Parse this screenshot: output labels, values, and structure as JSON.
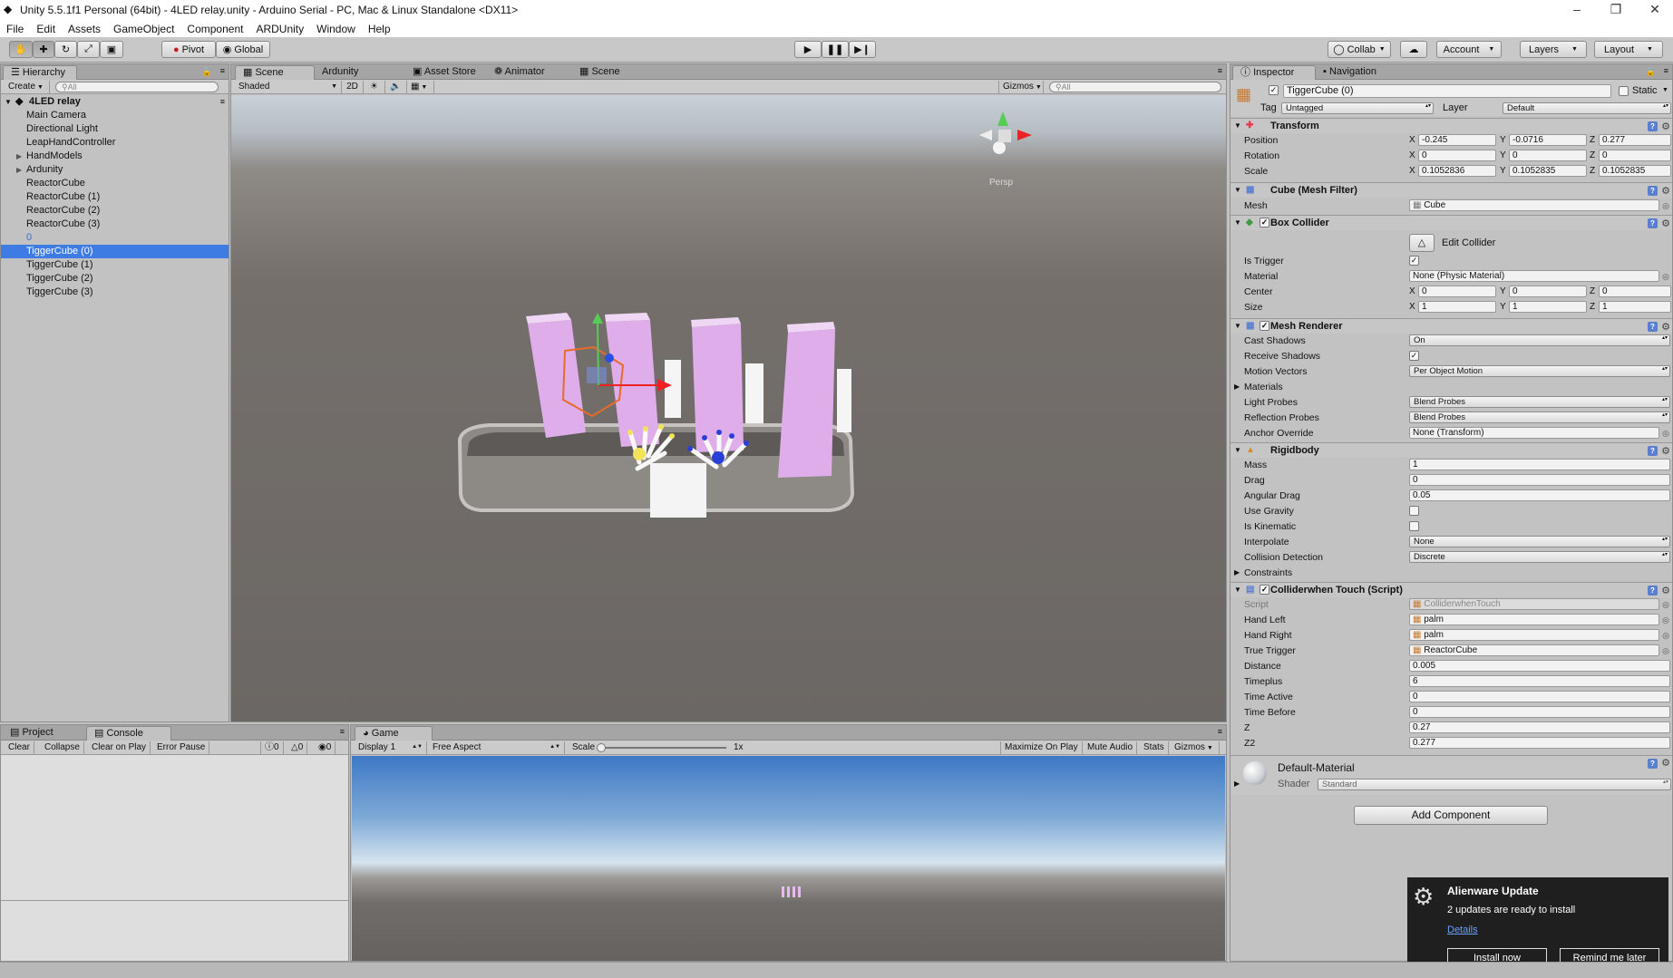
{
  "window": {
    "title": "Unity 5.5.1f1 Personal (64bit) - 4LED relay.unity - Arduino Serial - PC, Mac & Linux Standalone <DX11>"
  },
  "menu": [
    "File",
    "Edit",
    "Assets",
    "GameObject",
    "Component",
    "ARDUnity",
    "Window",
    "Help"
  ],
  "toolbar": {
    "pivot": "Pivot",
    "global": "Global",
    "collab": "Collab",
    "account": "Account",
    "layers": "Layers",
    "layout": "Layout"
  },
  "hierarchy": {
    "tab": "Hierarchy",
    "create": "Create",
    "search_placeholder": "All",
    "scene": "4LED relay",
    "items": [
      {
        "label": "Main Camera",
        "arrow": ""
      },
      {
        "label": "Directional Light",
        "arrow": ""
      },
      {
        "label": "LeapHandController",
        "arrow": ""
      },
      {
        "label": "HandModels",
        "arrow": "▶"
      },
      {
        "label": "Ardunity",
        "arrow": "▶"
      },
      {
        "label": "ReactorCube",
        "arrow": ""
      },
      {
        "label": "ReactorCube (1)",
        "arrow": ""
      },
      {
        "label": "ReactorCube (2)",
        "arrow": ""
      },
      {
        "label": "ReactorCube (3)",
        "arrow": ""
      },
      {
        "label": "0",
        "arrow": ""
      },
      {
        "label": "TiggerCube (0)",
        "arrow": ""
      },
      {
        "label": "TiggerCube (1)",
        "arrow": ""
      },
      {
        "label": "TiggerCube (2)",
        "arrow": ""
      },
      {
        "label": "TiggerCube (3)",
        "arrow": ""
      }
    ],
    "selected_index": 10
  },
  "scene_tabs": [
    "Scene",
    "Ardunity",
    "Asset Store",
    "Animator",
    "Scene"
  ],
  "scene_bar": {
    "shading": "Shaded",
    "mode_2d": "2D",
    "gizmos": "Gizmos",
    "search_placeholder": "All",
    "persp": "Persp"
  },
  "project_tabs": [
    "Project",
    "Console"
  ],
  "console_bar": {
    "buttons": [
      "Clear",
      "Collapse",
      "Clear on Play",
      "Error Pause"
    ],
    "counts": [
      "0",
      "0",
      "0"
    ]
  },
  "game": {
    "tab": "Game",
    "display": "Display 1",
    "aspect": "Free Aspect",
    "scale_label": "Scale",
    "scale_value": "1x",
    "scale_fraction": 0.0,
    "buttons": [
      "Maximize On Play",
      "Mute Audio",
      "Stats",
      "Gizmos"
    ]
  },
  "inspector": {
    "tabs": [
      "Inspector",
      "Navigation"
    ],
    "object_name": "TiggerCube (0)",
    "static_label": "Static",
    "tag_label": "Tag",
    "tag_value": "Untagged",
    "layer_label": "Layer",
    "layer_value": "Default",
    "transform": {
      "title": "Transform",
      "rows": [
        {
          "label": "Position",
          "x": "-0.245",
          "y": "-0.0716",
          "z": "0.277"
        },
        {
          "label": "Rotation",
          "x": "0",
          "y": "0",
          "z": "0"
        },
        {
          "label": "Scale",
          "x": "0.1052836",
          "y": "0.1052835",
          "z": "0.1052835"
        }
      ]
    },
    "mesh_filter": {
      "title": "Cube (Mesh Filter)",
      "mesh_label": "Mesh",
      "mesh_value": "Cube"
    },
    "box_collider": {
      "title": "Box Collider",
      "edit_label": "Edit Collider",
      "is_trigger_label": "Is Trigger",
      "is_trigger": true,
      "material_label": "Material",
      "material_value": "None (Physic Material)",
      "center_label": "Center",
      "center": {
        "x": "0",
        "y": "0",
        "z": "0"
      },
      "size_label": "Size",
      "size": {
        "x": "1",
        "y": "1",
        "z": "1"
      }
    },
    "mesh_renderer": {
      "title": "Mesh Renderer",
      "cast_shadows_label": "Cast Shadows",
      "cast_shadows": "On",
      "receive_shadows_label": "Receive Shadows",
      "receive_shadows": true,
      "motion_vectors_label": "Motion Vectors",
      "motion_vectors": "Per Object Motion",
      "materials_label": "Materials",
      "light_probes_label": "Light Probes",
      "light_probes": "Blend Probes",
      "reflection_probes_label": "Reflection Probes",
      "reflection_probes": "Blend Probes",
      "anchor_override_label": "Anchor Override",
      "anchor_override": "None (Transform)"
    },
    "rigidbody": {
      "title": "Rigidbody",
      "mass_label": "Mass",
      "mass": "1",
      "drag_label": "Drag",
      "drag": "0",
      "angular_drag_label": "Angular Drag",
      "angular_drag": "0.05",
      "use_gravity_label": "Use Gravity",
      "use_gravity": false,
      "is_kinematic_label": "Is Kinematic",
      "is_kinematic": false,
      "interpolate_label": "Interpolate",
      "interpolate": "None",
      "collision_label": "Collision Detection",
      "collision": "Discrete",
      "constraints_label": "Constraints"
    },
    "script": {
      "title": "Colliderwhen Touch (Script)",
      "rows": [
        {
          "label": "Script",
          "value": "ColliderwhenTouch",
          "kind": "obj-disabled"
        },
        {
          "label": "Hand Left",
          "value": "palm",
          "kind": "obj"
        },
        {
          "label": "Hand Right",
          "value": "palm",
          "kind": "obj"
        },
        {
          "label": "True Trigger",
          "value": "ReactorCube",
          "kind": "obj"
        },
        {
          "label": "Distance",
          "value": "0.005",
          "kind": "num"
        },
        {
          "label": "Timeplus",
          "value": "6",
          "kind": "num"
        },
        {
          "label": "Time Active",
          "value": "0",
          "kind": "num"
        },
        {
          "label": "Time Before",
          "value": "0",
          "kind": "num"
        },
        {
          "label": "Z",
          "value": "0.27",
          "kind": "num"
        },
        {
          "label": "Z2",
          "value": "0.277",
          "kind": "num"
        }
      ]
    },
    "material": {
      "name": "Default-Material",
      "shader_label": "Shader",
      "shader": "Standard"
    },
    "add_component": "Add Component"
  },
  "notification": {
    "title": "Alienware Update",
    "message": "2 updates are ready to install",
    "link": "Details",
    "install": "Install now",
    "remind": "Remind me later"
  },
  "colors": {
    "selection": "#3e7ce4",
    "pink_pillar": "#e8b4f0",
    "scene_ground": "#6e6b68",
    "notification_bg": "#1f1f1f"
  }
}
